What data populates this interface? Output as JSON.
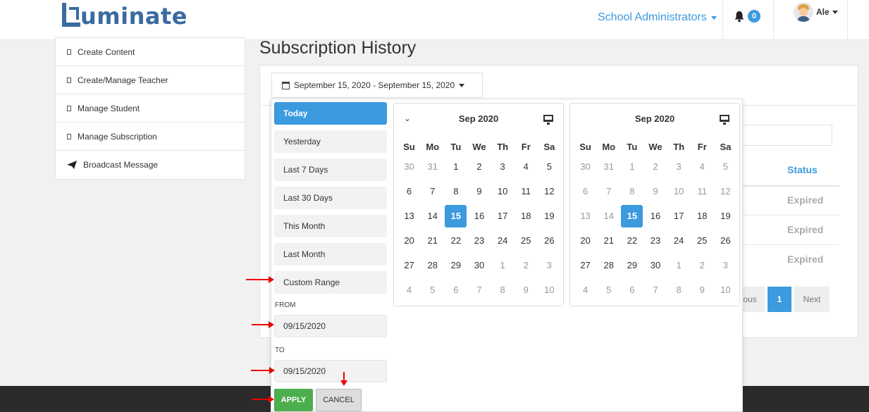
{
  "header": {
    "logo_text": "uminate",
    "role_menu": "School Administrators",
    "notifications_count": "0",
    "user_name": "Ale"
  },
  "sidebar": {
    "items": [
      {
        "label": "Create Content",
        "icon": "square-icon"
      },
      {
        "label": "Create/Manage Teacher",
        "icon": "square-icon"
      },
      {
        "label": "Manage Student",
        "icon": "square-icon"
      },
      {
        "label": "Manage Subscription",
        "icon": "square-icon"
      },
      {
        "label": "Broadcast Message",
        "icon": "paper-plane-icon"
      }
    ]
  },
  "main": {
    "title": "Subscription History",
    "date_range": "September 15, 2020 - September 15, 2020",
    "table": {
      "status_header": "Status",
      "statuses": [
        "Expired",
        "Expired",
        "Expired"
      ]
    },
    "pagination": {
      "prev": "ous",
      "page": "1",
      "next": "Next"
    }
  },
  "picker": {
    "ranges": [
      "Today",
      "Yesterday",
      "Last 7 Days",
      "Last 30 Days",
      "This Month",
      "Last Month",
      "Custom Range"
    ],
    "active_range": "Today",
    "from_label": "FROM",
    "from_value": "09/15/2020",
    "to_label": "TO",
    "to_value": "09/15/2020",
    "apply_label": "APPLY",
    "cancel_label": "CANCEL",
    "left_calendar": {
      "month": "Sep 2020"
    },
    "right_calendar": {
      "month": "Sep 2020"
    },
    "weekdays": [
      "Su",
      "Mo",
      "Tu",
      "We",
      "Th",
      "Fr",
      "Sa"
    ],
    "weeks": [
      [
        "30",
        "31",
        "1",
        "2",
        "3",
        "4",
        "5"
      ],
      [
        "6",
        "7",
        "8",
        "9",
        "10",
        "11",
        "12"
      ],
      [
        "13",
        "14",
        "15",
        "16",
        "17",
        "18",
        "19"
      ],
      [
        "20",
        "21",
        "22",
        "23",
        "24",
        "25",
        "26"
      ],
      [
        "27",
        "28",
        "29",
        "30",
        "1",
        "2",
        "3"
      ],
      [
        "4",
        "5",
        "6",
        "7",
        "8",
        "9",
        "10"
      ]
    ],
    "selected_day": "15"
  },
  "colors": {
    "accent": "#3c9ade",
    "apply": "#4cae4c",
    "annotation": "#e00000"
  }
}
